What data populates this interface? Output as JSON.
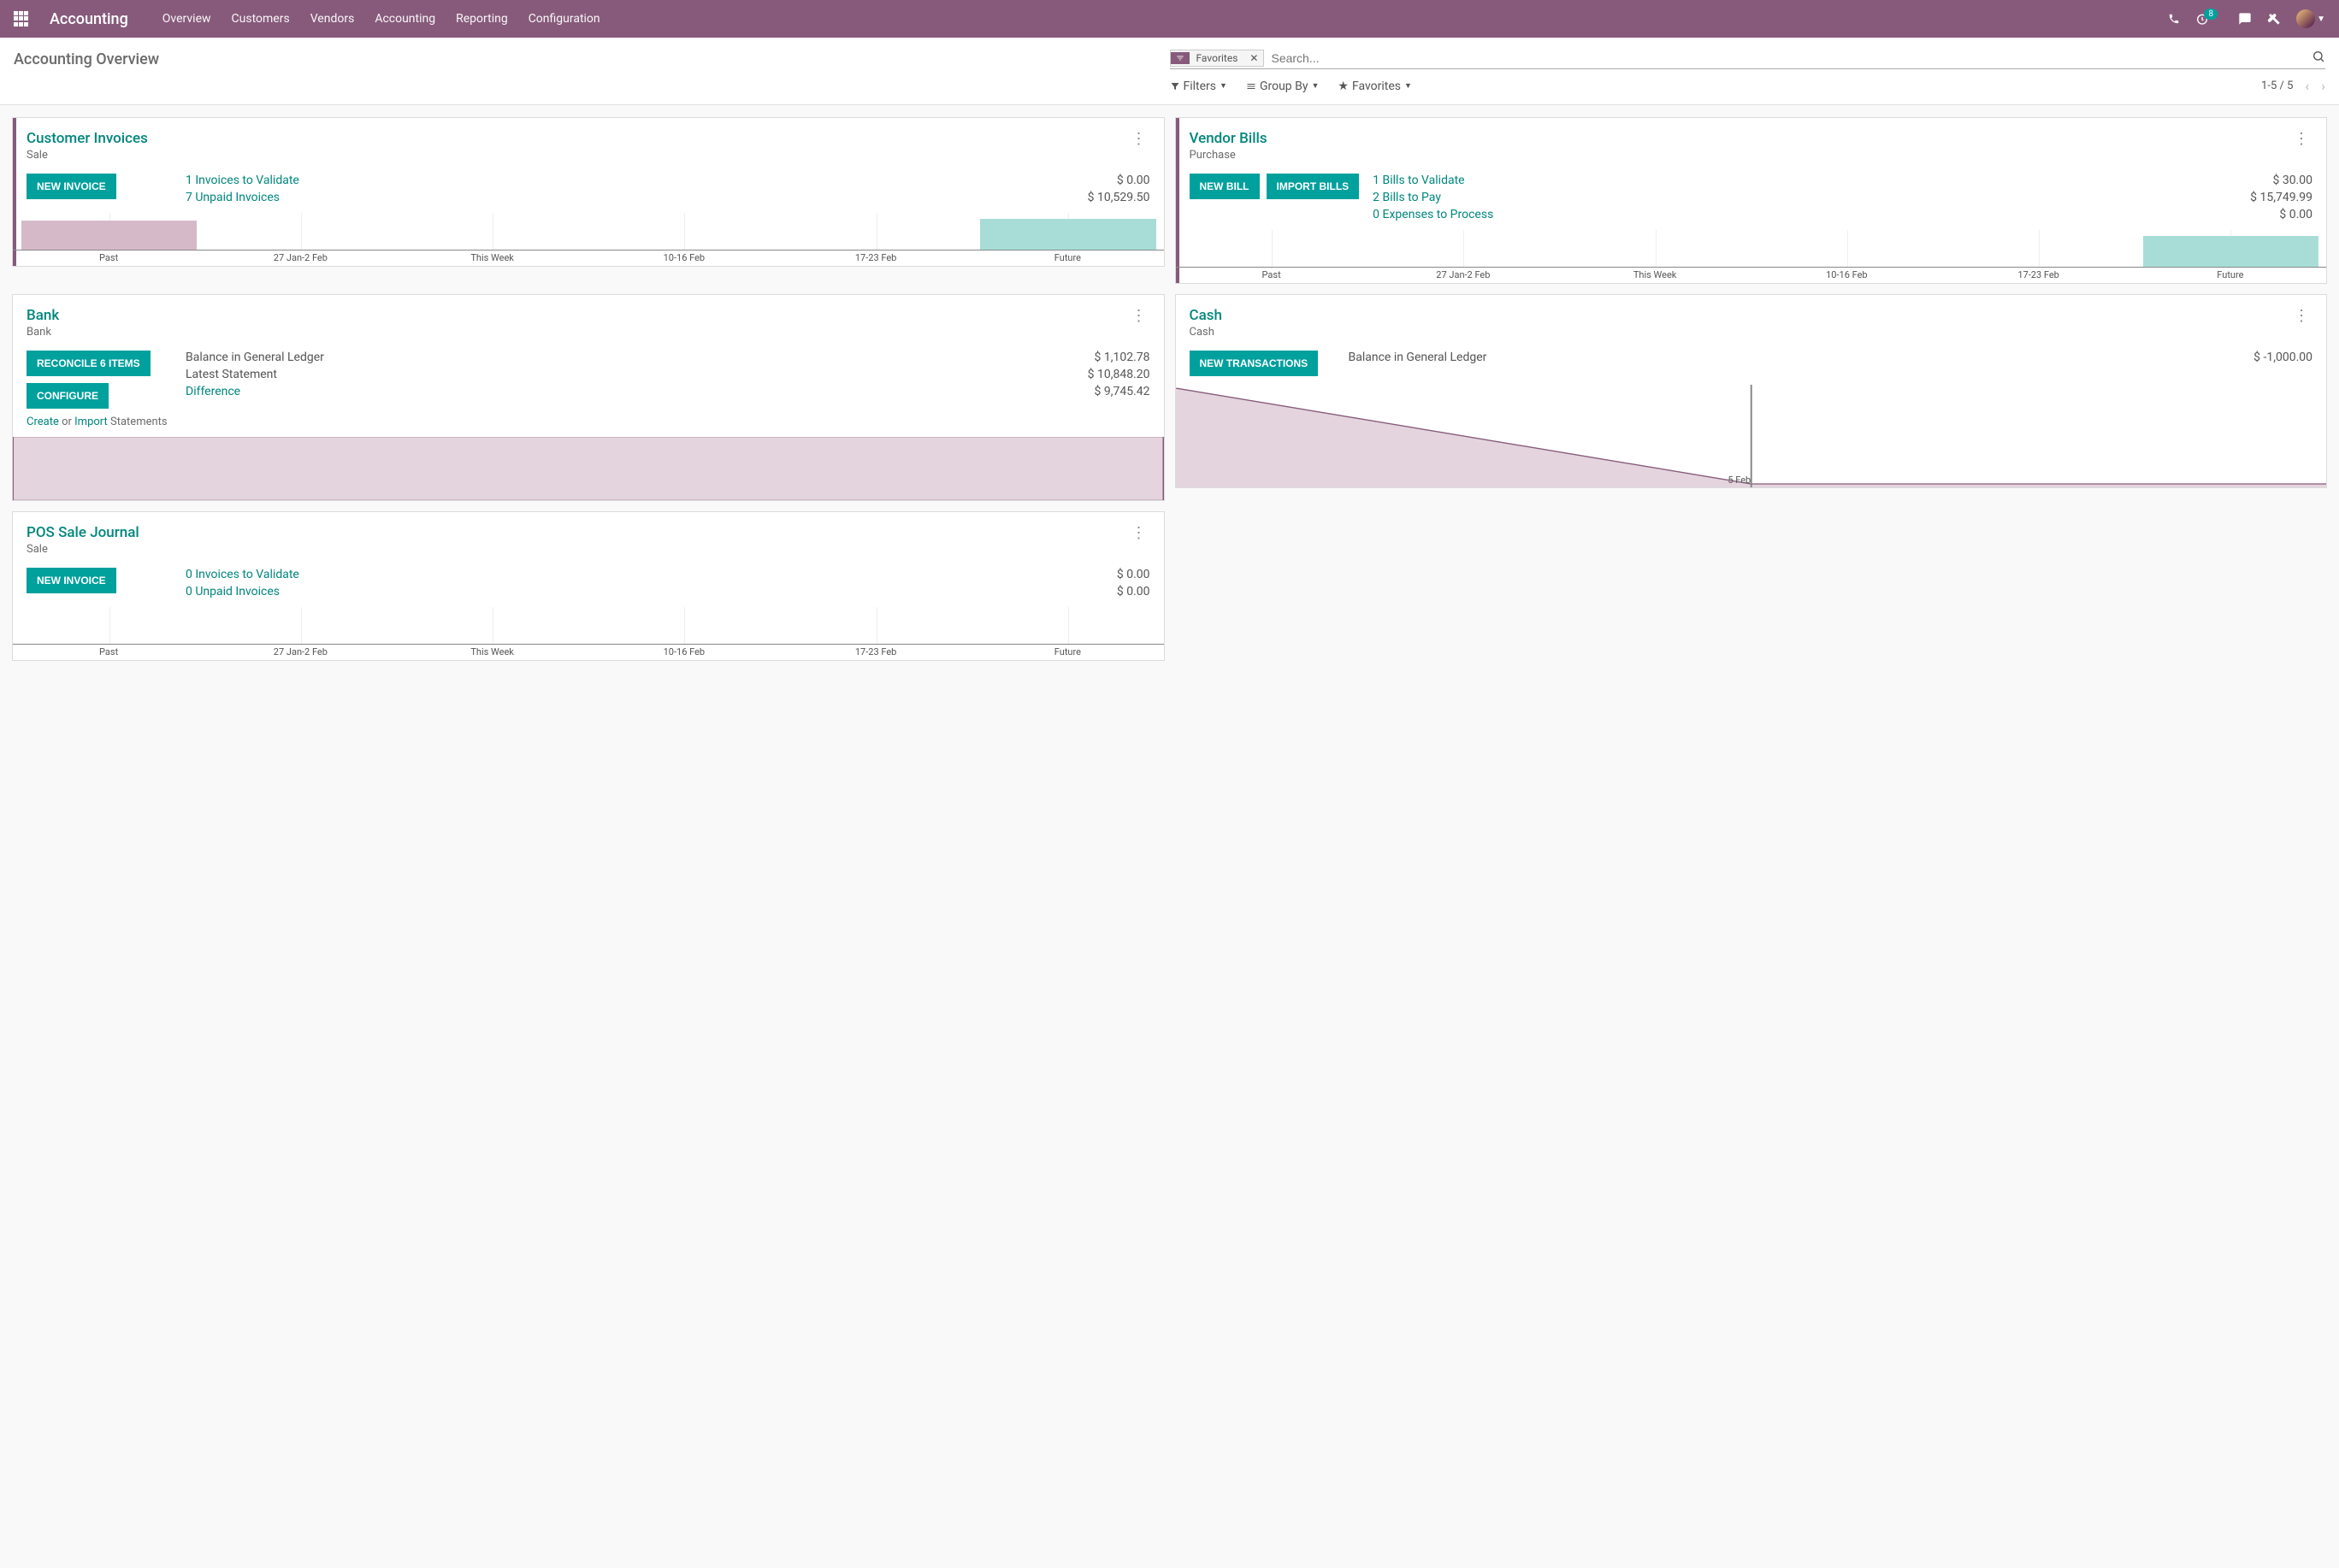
{
  "topbar": {
    "brand": "Accounting",
    "nav": [
      "Overview",
      "Customers",
      "Vendors",
      "Accounting",
      "Reporting",
      "Configuration"
    ],
    "badge_count": "8"
  },
  "page": {
    "title": "Accounting Overview",
    "search": {
      "facet": "Favorites",
      "placeholder": "Search..."
    },
    "subbuttons": {
      "filters": "Filters",
      "groupby": "Group By",
      "favorites": "Favorites"
    },
    "pager": "1-5 / 5"
  },
  "chart_axis": [
    "Past",
    "27 Jan-2 Feb",
    "This Week",
    "10-16 Feb",
    "17-23 Feb",
    "Future"
  ],
  "cards": {
    "customer_invoices": {
      "title": "Customer Invoices",
      "subtitle": "Sale",
      "actions": [
        "NEW INVOICE"
      ],
      "stats": [
        {
          "label": "1 Invoices to Validate",
          "amount": "$ 0.00",
          "link": true
        },
        {
          "label": "7 Unpaid Invoices",
          "amount": "$ 10,529.50",
          "link": true
        }
      ]
    },
    "vendor_bills": {
      "title": "Vendor Bills",
      "subtitle": "Purchase",
      "actions": [
        "NEW BILL",
        "IMPORT BILLS"
      ],
      "stats": [
        {
          "label": "1 Bills to Validate",
          "amount": "$ 30.00",
          "link": true
        },
        {
          "label": "2 Bills to Pay",
          "amount": "$ 15,749.99",
          "link": true
        },
        {
          "label": "0 Expenses to Process",
          "amount": "$ 0.00",
          "link": true
        }
      ]
    },
    "bank": {
      "title": "Bank",
      "subtitle": "Bank",
      "actions": [
        "RECONCILE 6 ITEMS",
        "CONFIGURE"
      ],
      "statement_links": {
        "create": "Create",
        "or": " or ",
        "import": "Import",
        "rest": " Statements"
      },
      "stats": [
        {
          "label": "Balance in General Ledger",
          "amount": "$ 1,102.78",
          "link": false
        },
        {
          "label": "Latest Statement",
          "amount": "$ 10,848.20",
          "link": false
        },
        {
          "label": "Difference",
          "amount": "$ 9,745.42",
          "link": true
        }
      ]
    },
    "cash": {
      "title": "Cash",
      "subtitle": "Cash",
      "actions": [
        "NEW TRANSACTIONS"
      ],
      "stats": [
        {
          "label": "Balance in General Ledger",
          "amount": "$ -1,000.00",
          "link": false
        }
      ],
      "chart_label": "5 Feb"
    },
    "pos": {
      "title": "POS Sale Journal",
      "subtitle": "Sale",
      "actions": [
        "NEW INVOICE"
      ],
      "stats": [
        {
          "label": "0 Invoices to Validate",
          "amount": "$ 0.00",
          "link": true
        },
        {
          "label": "0 Unpaid Invoices",
          "amount": "$ 0.00",
          "link": true
        }
      ]
    }
  },
  "chart_data": [
    {
      "type": "bar",
      "title": "Customer Invoices",
      "categories": [
        "Past",
        "27 Jan-2 Feb",
        "This Week",
        "10-16 Feb",
        "17-23 Feb",
        "Future"
      ],
      "series": [
        {
          "name": "past-due",
          "color": "#d6b9c9",
          "values": [
            38,
            0,
            0,
            0,
            0,
            0
          ]
        },
        {
          "name": "future",
          "color": "#a8ddd7",
          "values": [
            0,
            0,
            0,
            0,
            0,
            40
          ]
        }
      ],
      "ylim": [
        0,
        100
      ]
    },
    {
      "type": "bar",
      "title": "Vendor Bills",
      "categories": [
        "Past",
        "27 Jan-2 Feb",
        "This Week",
        "10-16 Feb",
        "17-23 Feb",
        "Future"
      ],
      "series": [
        {
          "name": "future",
          "color": "#a8ddd7",
          "values": [
            0,
            0,
            0,
            0,
            0,
            40
          ]
        }
      ],
      "ylim": [
        0,
        100
      ]
    },
    {
      "type": "area",
      "title": "Bank",
      "x": [
        0,
        100
      ],
      "values": [
        1,
        1
      ],
      "color": "#d6b9c9"
    },
    {
      "type": "area",
      "title": "Cash",
      "x": [
        0,
        50,
        100
      ],
      "values": [
        0,
        -1000,
        -1000
      ],
      "label_point": "5 Feb",
      "color": "#d6b9c9"
    },
    {
      "type": "bar",
      "title": "POS Sale Journal",
      "categories": [
        "Past",
        "27 Jan-2 Feb",
        "This Week",
        "10-16 Feb",
        "17-23 Feb",
        "Future"
      ],
      "series": [
        {
          "name": "none",
          "values": [
            0,
            0,
            0,
            0,
            0,
            0
          ]
        }
      ],
      "ylim": [
        0,
        100
      ]
    }
  ]
}
